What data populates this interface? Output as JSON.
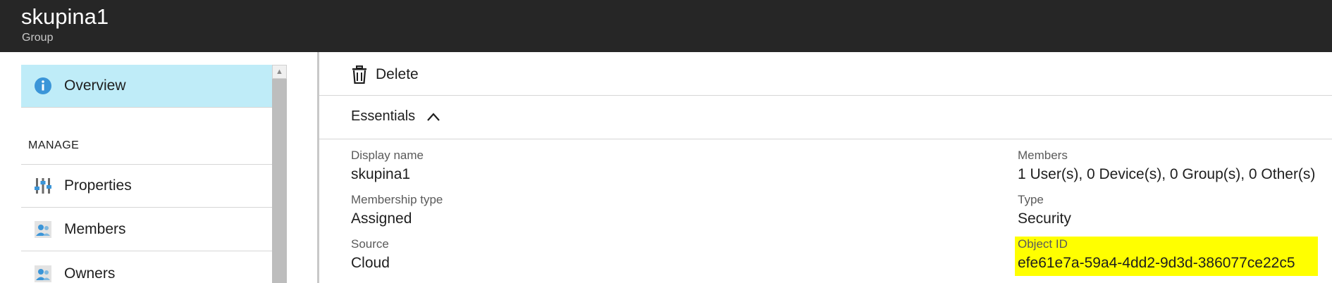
{
  "header": {
    "title": "skupina1",
    "subtitle": "Group"
  },
  "sidebar": {
    "overview_label": "Overview",
    "section_label": "MANAGE",
    "items": [
      {
        "label": "Properties",
        "icon": "properties-icon"
      },
      {
        "label": "Members",
        "icon": "members-icon"
      },
      {
        "label": "Owners",
        "icon": "owners-icon"
      }
    ]
  },
  "toolbar": {
    "delete_label": "Delete"
  },
  "essentials": {
    "label": "Essentials",
    "fields": {
      "display_name": {
        "key": "Display name",
        "value": "skupina1"
      },
      "membership_type": {
        "key": "Membership type",
        "value": "Assigned"
      },
      "source": {
        "key": "Source",
        "value": "Cloud"
      },
      "members": {
        "key": "Members",
        "value": "1 User(s), 0 Device(s), 0 Group(s), 0 Other(s)"
      },
      "type": {
        "key": "Type",
        "value": "Security"
      },
      "object_id": {
        "key": "Object ID",
        "value": "efe61e7a-59a4-4dd2-9d3d-386077ce22c5"
      }
    }
  },
  "colors": {
    "header_bg": "#262626",
    "active_item_bg": "#bfecf8",
    "highlight": "#ffff00",
    "info_icon": "#3b95d8"
  }
}
